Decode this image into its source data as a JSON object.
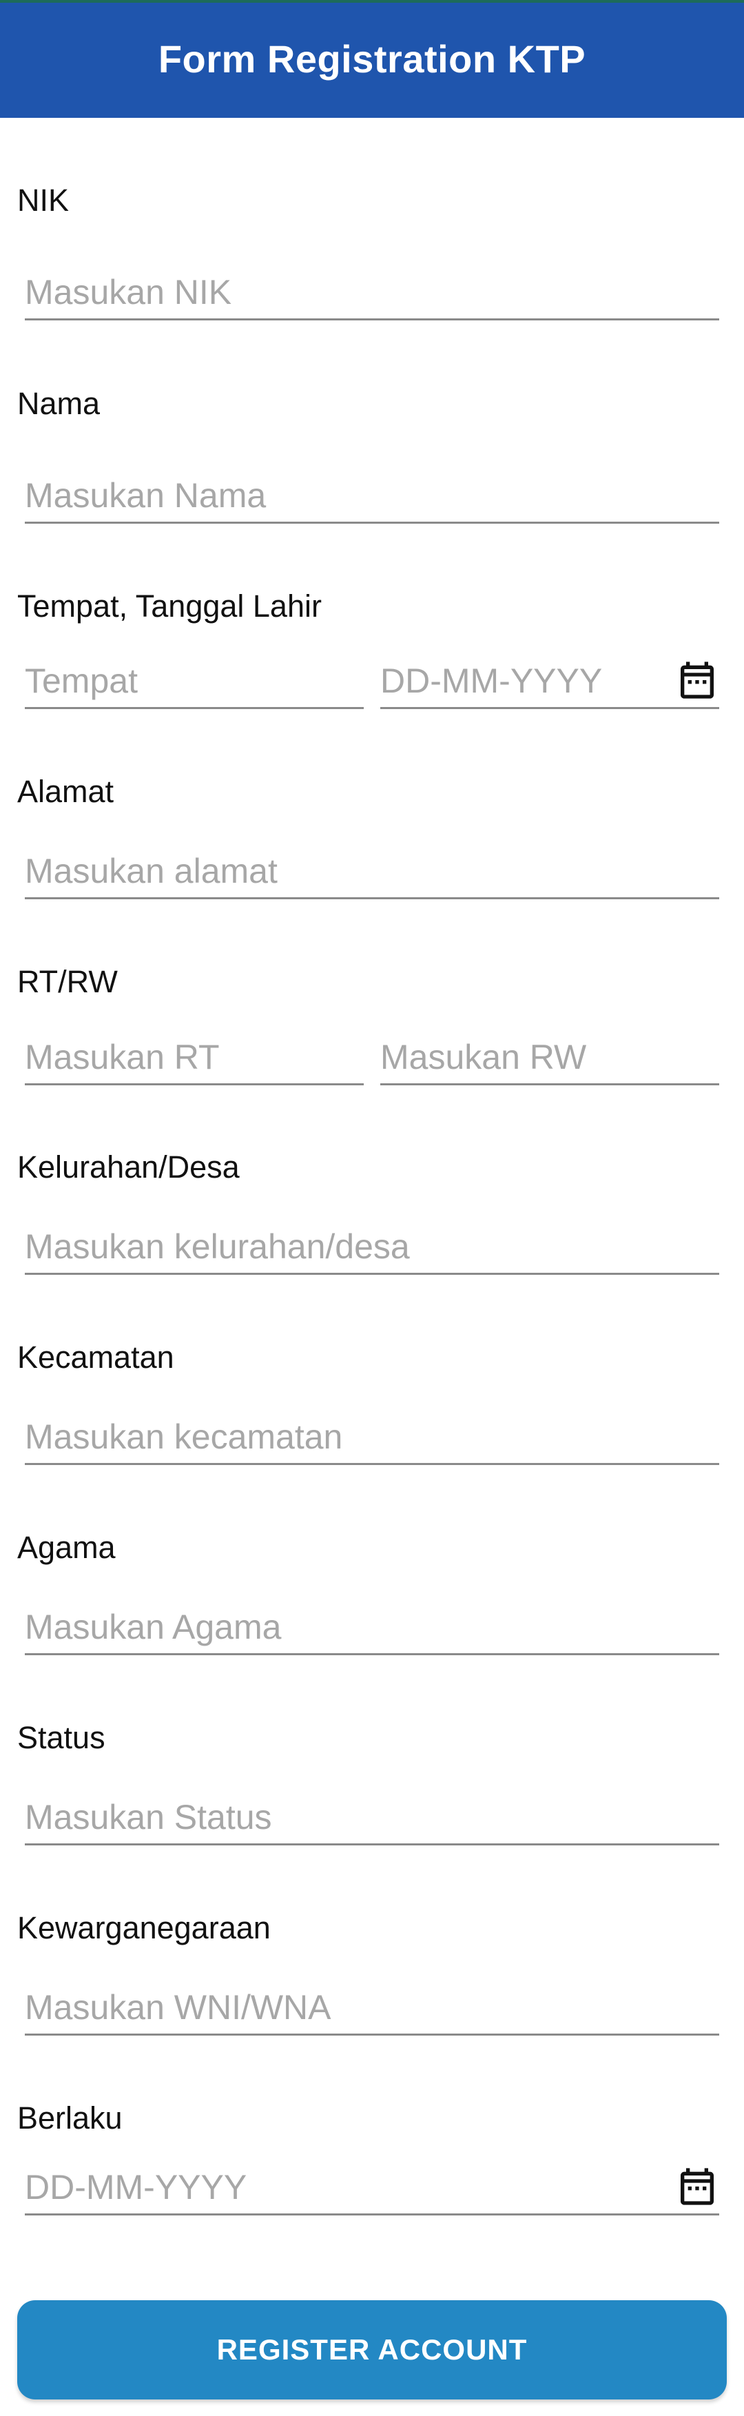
{
  "appbar": {
    "title": "Form Registration KTP",
    "color": "#1f55ad"
  },
  "form": {
    "nik": {
      "label": "NIK",
      "placeholder": "Masukan NIK"
    },
    "nama": {
      "label": "Nama",
      "placeholder": "Masukan Nama"
    },
    "ttl": {
      "label": "Tempat, Tanggal Lahir",
      "tempat_placeholder": "Tempat",
      "tanggal_placeholder": "DD-MM-YYYY",
      "tanggal_icon": "calendar-icon"
    },
    "alamat": {
      "label": "Alamat",
      "placeholder": "Masukan alamat"
    },
    "rtrw": {
      "label": "RT/RW",
      "rt_placeholder": "Masukan RT",
      "rw_placeholder": "Masukan RW"
    },
    "kelurahan": {
      "label": "Kelurahan/Desa",
      "placeholder": "Masukan kelurahan/desa"
    },
    "kecamatan": {
      "label": "Kecamatan",
      "placeholder": "Masukan kecamatan"
    },
    "agama": {
      "label": "Agama",
      "placeholder": "Masukan Agama"
    },
    "status": {
      "label": "Status",
      "placeholder": "Masukan Status"
    },
    "kewarganegaraan": {
      "label": "Kewarganegaraan",
      "placeholder": "Masukan WNI/WNA"
    },
    "berlaku": {
      "label": "Berlaku",
      "placeholder": "DD-MM-YYYY",
      "icon": "calendar-icon"
    }
  },
  "register_button": {
    "label": "REGISTER ACCOUNT",
    "color": "#2388c4"
  }
}
